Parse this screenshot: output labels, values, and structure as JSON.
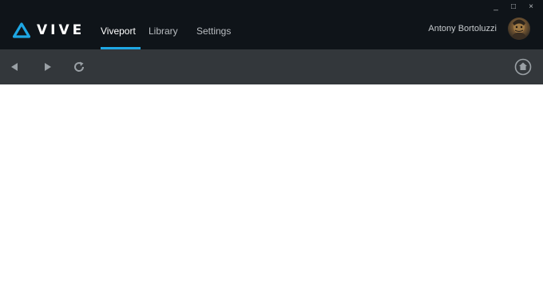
{
  "window": {
    "controls": {
      "minimize": "_",
      "maximize": "□",
      "close": "×"
    }
  },
  "header": {
    "logo_text": "VIVE",
    "nav": {
      "tabs": [
        {
          "label": "Viveport",
          "active": true
        },
        {
          "label": "Library",
          "active": false
        },
        {
          "label": "Settings",
          "active": false
        }
      ]
    },
    "user": {
      "name": "Antony Bortoluzzi",
      "avatar_icon": "user-avatar"
    }
  },
  "toolbar": {
    "icons": {
      "back": "back-arrow-icon",
      "forward": "forward-arrow-icon",
      "refresh": "refresh-icon",
      "home": "home-icon"
    }
  },
  "colors": {
    "header_bg": "#0f1419",
    "toolbar_bg": "#33373b",
    "accent": "#1ea7e4",
    "content_bg": "#ffffff"
  }
}
